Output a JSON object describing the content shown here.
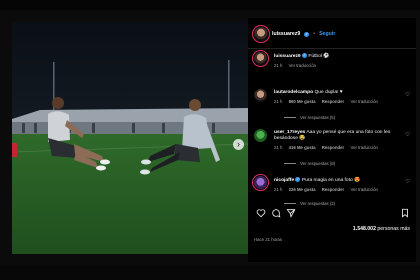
{
  "post": {
    "author": "luissuarez9",
    "follow_label": "Seguir",
    "separator": "•"
  },
  "caption": {
    "author": "luissuarez9",
    "text": "Fútbol",
    "emoji": "⚽",
    "time": "21 h",
    "translate": "Ver traducción"
  },
  "comments": [
    {
      "author": "lautarodelcampo",
      "text": "Que dupla!",
      "emoji": "♥",
      "time": "21 h",
      "likes": "860 Me gusta",
      "reply": "Responder",
      "translate": "Ver traducción",
      "replies": "Ver respuestas (5)"
    },
    {
      "author": "user_17reyes",
      "text": "Aaa yo pensé que era una foto con leo besándose",
      "emoji": "😂",
      "time": "21 h",
      "likes": "416 Me gusta",
      "reply": "Responder",
      "translate": "Ver traducción",
      "replies": "Ver respuestas (8)"
    },
    {
      "author": "nicojaffe",
      "text": "Pura magia en una foto",
      "emoji": "😍",
      "time": "21 h",
      "likes": "226 Me gusta",
      "reply": "Responder",
      "translate": "Ver traducción",
      "replies": "Ver respuestas (2)"
    }
  ],
  "footer": {
    "likes_count": "1.548.002",
    "likes_suffix": "personas más",
    "ago": "Hace 21 horas"
  },
  "icons": [
    "heart-icon",
    "comment-icon",
    "share-icon",
    "bookmark-icon",
    "verified-icon",
    "chevron-right-icon"
  ]
}
